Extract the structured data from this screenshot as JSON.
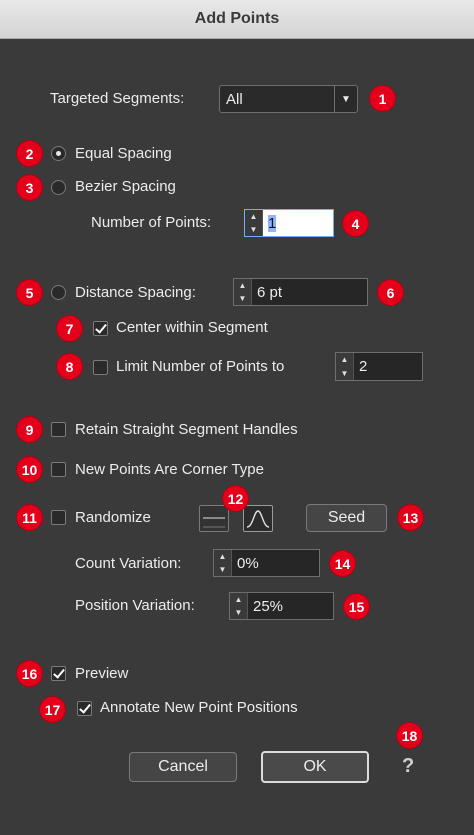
{
  "window": {
    "title": "Add Points"
  },
  "targeted_segments": {
    "label": "Targeted Segments:",
    "value": "All"
  },
  "equal_spacing": {
    "label": "Equal Spacing",
    "selected": true
  },
  "bezier_spacing": {
    "label": "Bezier Spacing",
    "selected": false
  },
  "number_of_points": {
    "label": "Number of Points:",
    "value": "1"
  },
  "distance_spacing": {
    "label": "Distance Spacing:",
    "value": "6 pt",
    "selected": false
  },
  "center_within_segment": {
    "label": "Center within Segment",
    "checked": true
  },
  "limit_points": {
    "label": "Limit Number of Points to",
    "value": "2",
    "checked": false
  },
  "retain_handles": {
    "label": "Retain Straight Segment Handles",
    "checked": false
  },
  "corner_type": {
    "label": "New Points Are Corner Type",
    "checked": false
  },
  "randomize": {
    "label": "Randomize",
    "checked": false,
    "seed_label": "Seed"
  },
  "count_variation": {
    "label": "Count Variation:",
    "value": "0%"
  },
  "position_variation": {
    "label": "Position Variation:",
    "value": "25%"
  },
  "preview": {
    "label": "Preview",
    "checked": true
  },
  "annotate": {
    "label": "Annotate New Point Positions",
    "checked": true
  },
  "buttons": {
    "cancel": "Cancel",
    "ok": "OK",
    "help": "?"
  },
  "badges": [
    "1",
    "2",
    "3",
    "4",
    "5",
    "6",
    "7",
    "8",
    "9",
    "10",
    "11",
    "12",
    "13",
    "14",
    "15",
    "16",
    "17",
    "18"
  ],
  "colors": {
    "badge": "#e4001b",
    "background": "#3a3a3a"
  }
}
